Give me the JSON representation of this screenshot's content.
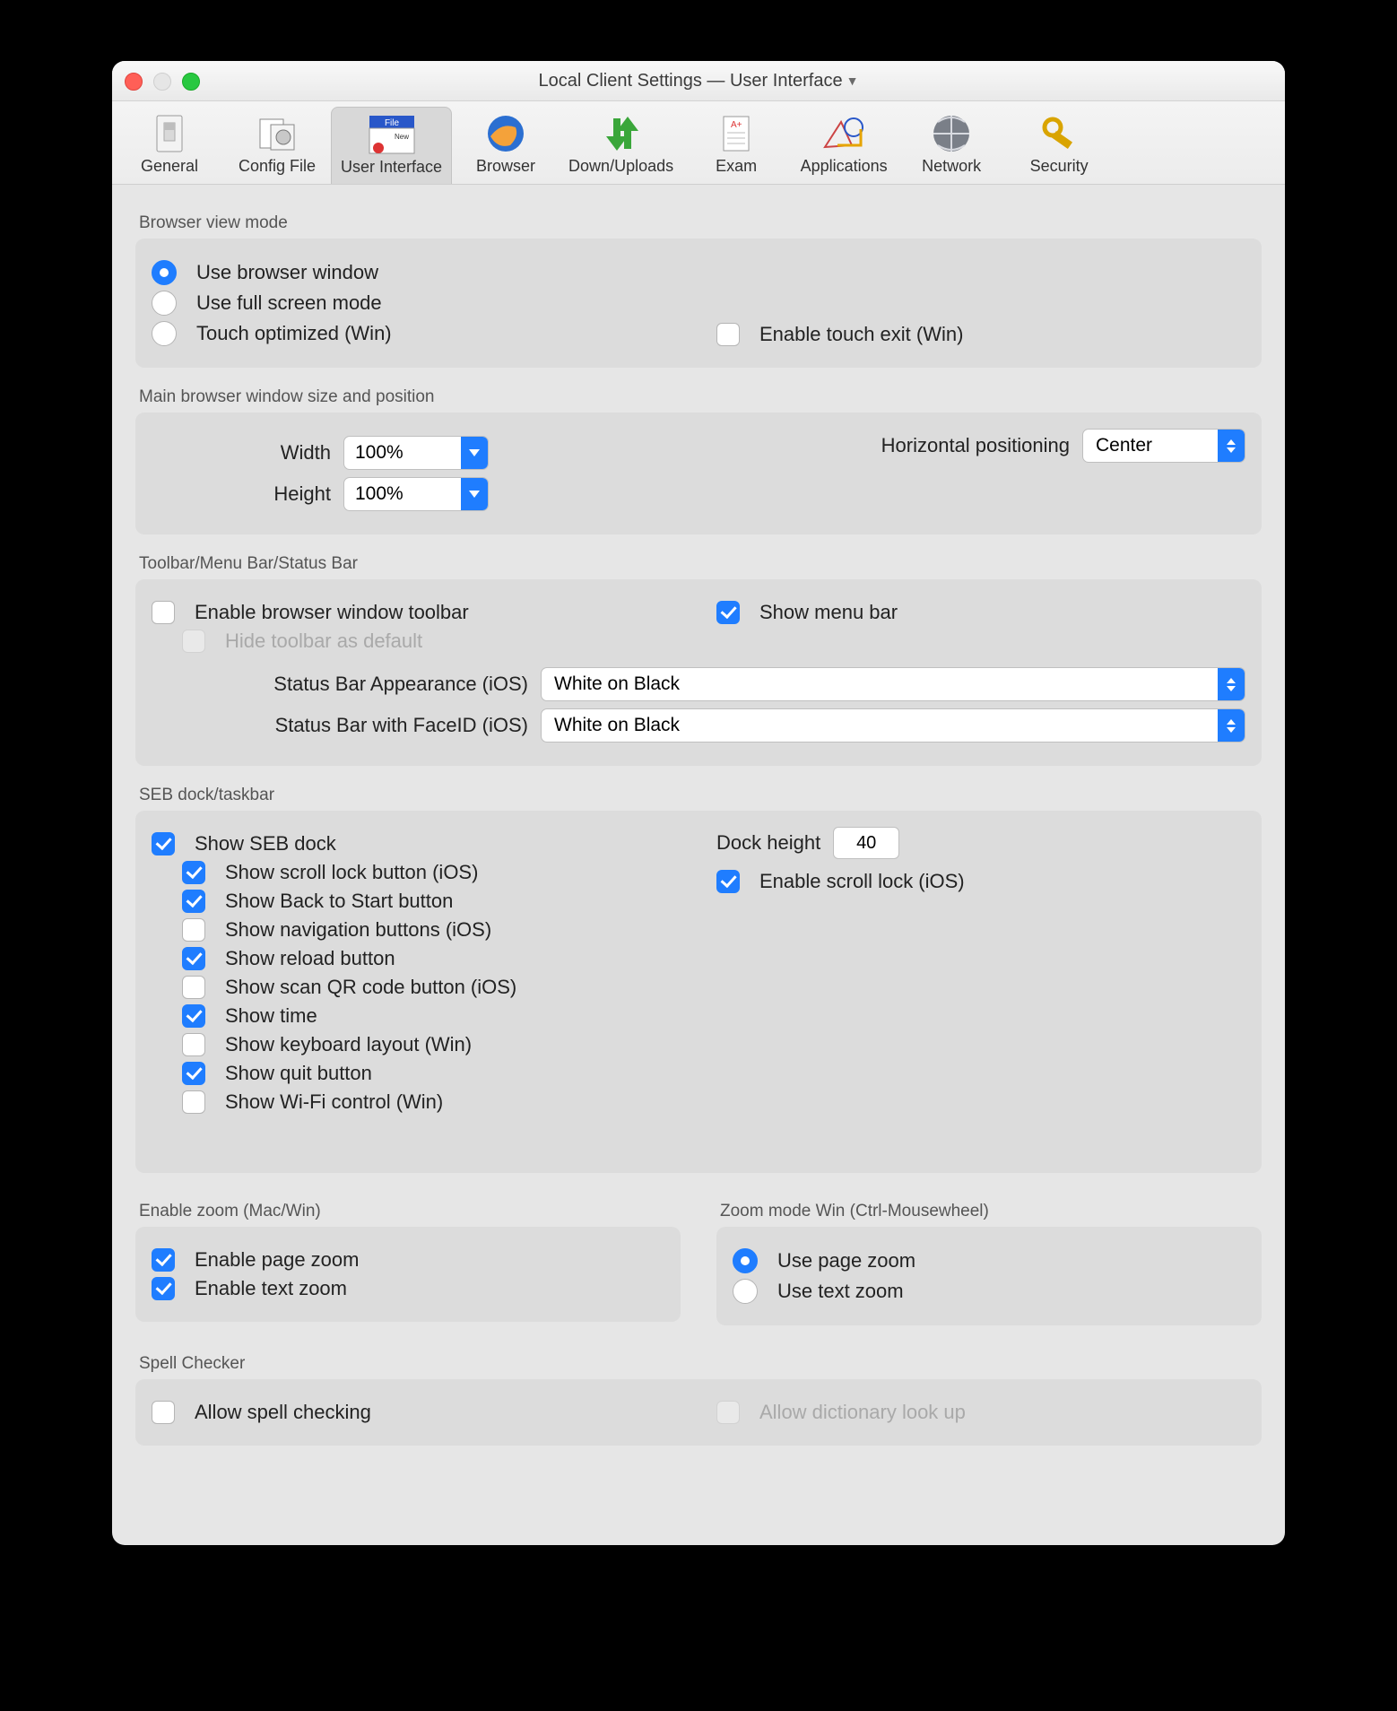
{
  "window": {
    "title": "Local Client Settings  —  User Interface"
  },
  "toolbar": {
    "items": [
      "General",
      "Config File",
      "User Interface",
      "Browser",
      "Down/Uploads",
      "Exam",
      "Applications",
      "Network",
      "Security"
    ],
    "active_index": 2
  },
  "sections": {
    "browser_view_mode": {
      "title": "Browser view mode",
      "options": [
        "Use browser window",
        "Use full screen mode",
        "Touch optimized (Win)"
      ],
      "selected_index": 0,
      "enable_touch_exit": "Enable touch exit (Win)",
      "enable_touch_exit_checked": false
    },
    "main_window": {
      "title": "Main browser window size and position",
      "width_label": "Width",
      "width": "100%",
      "height_label": "Height",
      "height": "100%",
      "hpos_label": "Horizontal positioning",
      "hpos": "Center"
    },
    "toolbar": {
      "title": "Toolbar/Menu Bar/Status Bar",
      "enable_toolbar": "Enable browser window toolbar",
      "enable_toolbar_checked": false,
      "hide_default": "Hide toolbar as default",
      "hide_default_enabled": false,
      "show_menu_bar": "Show menu bar",
      "show_menu_bar_checked": true,
      "status_ios_label": "Status Bar Appearance (iOS)",
      "status_ios": "White on Black",
      "status_faceid_label": "Status Bar with FaceID (iOS)",
      "status_faceid": "White on Black"
    },
    "dock": {
      "title": "SEB dock/taskbar",
      "show_dock": "Show SEB dock",
      "show_dock_checked": true,
      "items": [
        "Show scroll lock button (iOS)",
        "Show Back to Start button",
        "Show navigation buttons (iOS)",
        "Show reload button",
        "Show scan QR code button (iOS)",
        "Show time",
        "Show keyboard layout (Win)",
        "Show quit button",
        "Show Wi-Fi control (Win)"
      ],
      "items_checked": [
        true,
        true,
        false,
        true,
        false,
        true,
        false,
        true,
        false
      ],
      "height_label": "Dock height",
      "height": "40",
      "enable_scroll_lock": "Enable scroll lock (iOS)",
      "enable_scroll_lock_checked": true
    },
    "zoom": {
      "enable_title": "Enable zoom (Mac/Win)",
      "enable_page": "Enable page zoom",
      "enable_page_checked": true,
      "enable_text": "Enable text zoom",
      "enable_text_checked": true,
      "mode_title": "Zoom mode Win (Ctrl-Mousewheel)",
      "use_page": "Use page zoom",
      "use_text": "Use text zoom",
      "mode_selected": "page"
    },
    "spell": {
      "title": "Spell Checker",
      "allow_spell": "Allow spell checking",
      "allow_spell_checked": false,
      "allow_dict": "Allow dictionary look up",
      "allow_dict_enabled": false
    }
  }
}
